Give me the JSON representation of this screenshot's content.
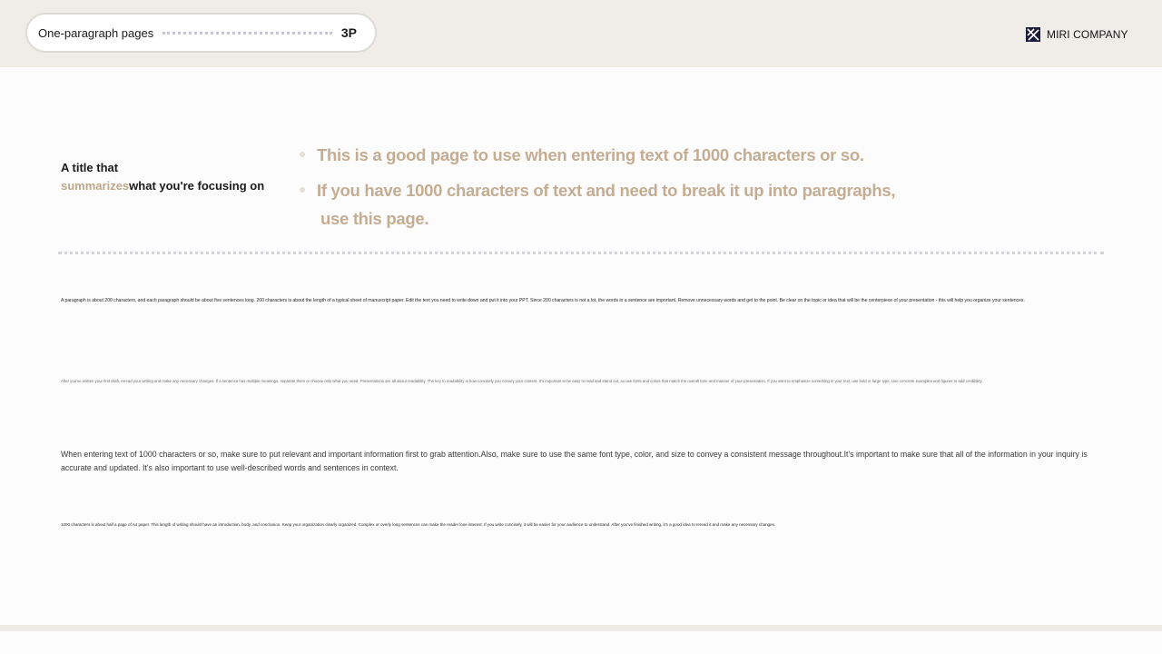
{
  "header": {
    "section_label": "One-paragraph pages",
    "page_count": "3P",
    "company_name": "MIRI COMPANY",
    "company_logo": "miri-company-logo-icon"
  },
  "title_block": {
    "line1": "A title that",
    "accent": "summarizes",
    "rest": "what you're focusing on"
  },
  "bullets": [
    {
      "text": "This is a good page to use when entering text of 1000 characters or so."
    },
    {
      "line1": "If you have 1000 characters of text and need to break it up into paragraphs,",
      "line2": "use this page."
    }
  ],
  "paragraphs": [
    "A paragraph is about 200 characters, and each paragraph should be about five sentences long. 200 characters is about the length of a typical sheet of manuscript paper. Edit the text you need to write down and put it into your PPT. Since 200 characters is not a lot, the words in a sentence are important. Remove unnecessary words and get to the point. Be clear on the topic or idea that will be the centerpiece of your presentation - this will help you organize your sentences.",
    "After you've written your first draft, reread your writing and make any necessary changes. If a sentence has multiple meanings, separate them or choose only what you need. Presentations are all about readability. The key to readability is how concisely you convey your content. It's important to be easy to read and stand out, so use fonts and colors that match the overall tone and manner of your presentation. If you want to emphasize something in your text, use bold or large type. Use concrete examples and figures to add credibility.",
    "When entering text of 1000 characters or so, make sure to put relevant and important information first to grab attention.Also, make sure to use the same font type, color, and size to convey a consistent message throughout.It's important to make sure that all of the information in your inquiry is accurate and updated. It's also important to use well-described words and sentences in context.",
    "1000 characters is about half a page of A4 paper. This length of writing should have an introduction, body, and conclusion. Keep your organization clearly organized. Complex or overly long sentences can make the reader lose interest. If you write concisely, it will be easier for your audience to understand. After you've finished writing, it's a good idea to reread it and make any necessary changes."
  ],
  "colors": {
    "header_bg": "#f0ece8",
    "accent": "#bfa78b",
    "bullet_text": "#c4ad92",
    "divider": "#d6d2e0"
  }
}
